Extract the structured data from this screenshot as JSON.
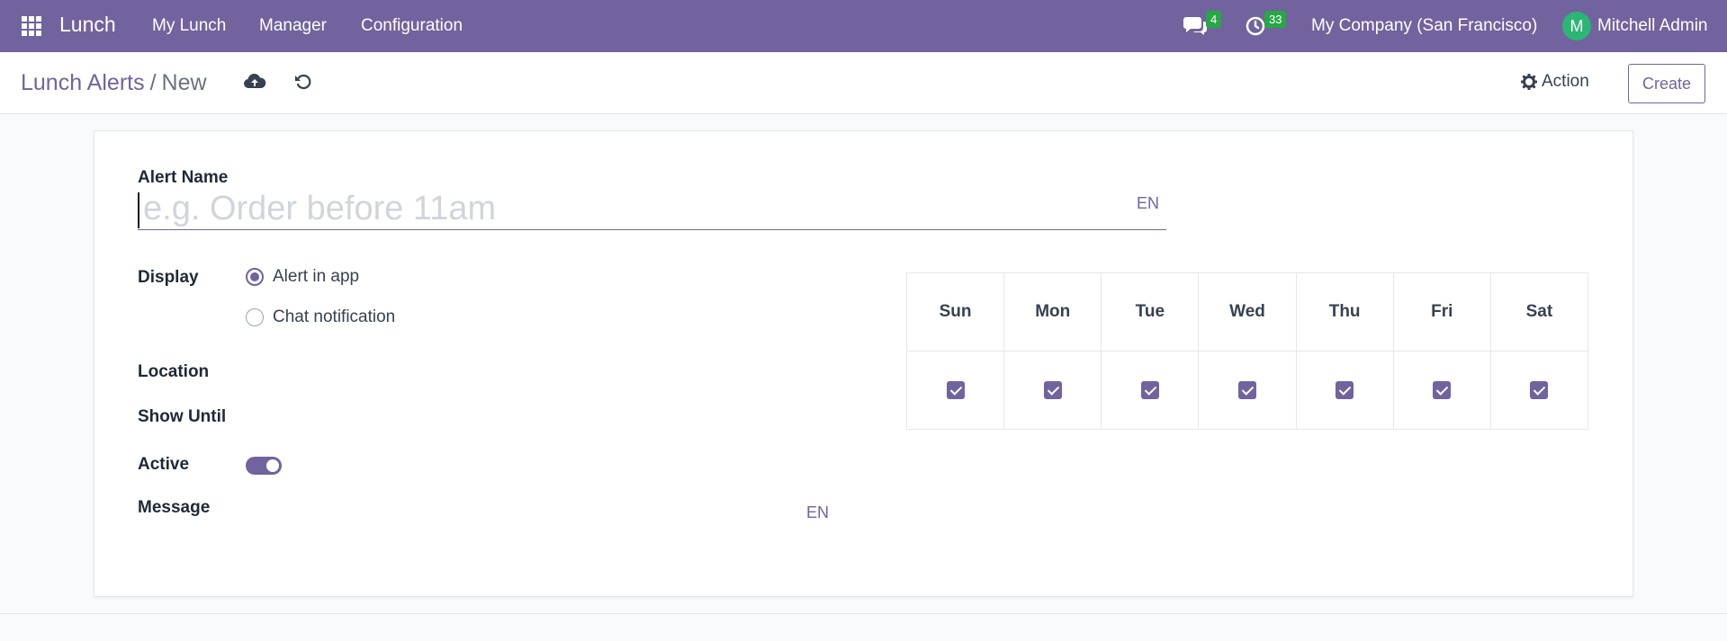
{
  "navbar": {
    "app_name": "Lunch",
    "menu": [
      "My Lunch",
      "Manager",
      "Configuration"
    ],
    "messages_count": "4",
    "activities_count": "33",
    "company": "My Company (San Francisco)",
    "user_initial": "M",
    "user_name": "Mitchell Admin",
    "accent_color": "#71639e"
  },
  "control_panel": {
    "breadcrumb_parent": "Lunch Alerts",
    "breadcrumb_separator": "/",
    "breadcrumb_current": "New",
    "action_label": "Action",
    "create_label": "Create"
  },
  "form": {
    "alert_name_label": "Alert Name",
    "alert_name_placeholder": "e.g. Order before 11am",
    "alert_name_value": "",
    "name_lang": "EN",
    "display_label": "Display",
    "display_options": [
      {
        "label": "Alert in app",
        "checked": true
      },
      {
        "label": "Chat notification",
        "checked": false
      }
    ],
    "location_label": "Location",
    "show_until_label": "Show Until",
    "active_label": "Active",
    "active_value": true,
    "message_label": "Message",
    "message_lang": "EN",
    "days": [
      {
        "label": "Sun",
        "checked": true
      },
      {
        "label": "Mon",
        "checked": true
      },
      {
        "label": "Tue",
        "checked": true
      },
      {
        "label": "Wed",
        "checked": true
      },
      {
        "label": "Thu",
        "checked": true
      },
      {
        "label": "Fri",
        "checked": true
      },
      {
        "label": "Sat",
        "checked": true
      }
    ]
  }
}
